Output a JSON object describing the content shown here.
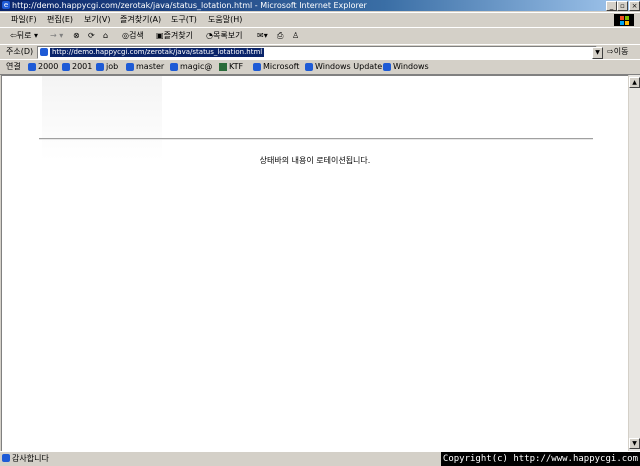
{
  "window": {
    "title": "http://demo.happycgi.com/zerotak/java/status_lotation.html - Microsoft Internet Explorer",
    "controls": [
      "_",
      "▫",
      "×"
    ]
  },
  "menu": [
    "파일(F)",
    "편집(E)",
    "보기(V)",
    "즐겨찾기(A)",
    "도구(T)",
    "도움말(H)"
  ],
  "toolbar": {
    "back": "뒤로",
    "forward": "→",
    "search": "검색",
    "favorites": "즐겨찾기",
    "history": "목록보기"
  },
  "address": {
    "label": "주소(D)",
    "url": "http://demo.happycgi.com/zerotak/java/status_lotation.html",
    "go": "이동"
  },
  "links": {
    "label": "연결",
    "items": [
      "2000",
      "2001",
      "job",
      "master",
      "magic@",
      "KTF",
      "Microsoft",
      "Windows Update",
      "Windows"
    ]
  },
  "page": {
    "message": "상태바의 내용이 로테이션됩니다."
  },
  "status": {
    "text": "감사합니다",
    "overlay": "Copyright(c) http://www.happycgi.com"
  },
  "colors": {
    "titlebar": "#0a246a",
    "chrome": "#d4d0c8",
    "selection": "#0a246a"
  }
}
